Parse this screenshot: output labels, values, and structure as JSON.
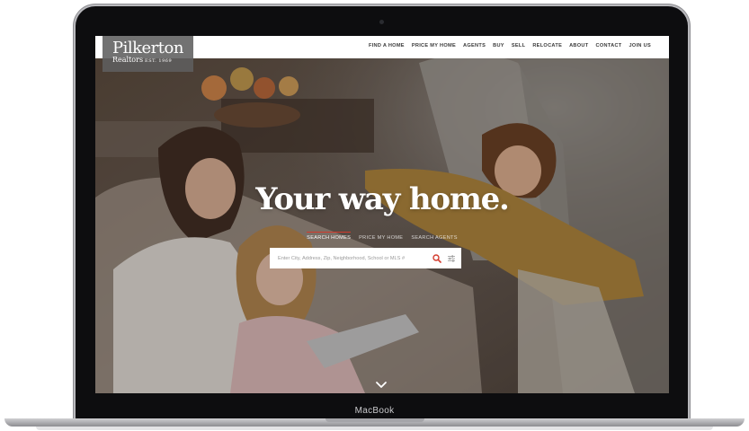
{
  "device": {
    "label": "MacBook"
  },
  "header": {
    "logo": {
      "name": "Pilkerton",
      "subtitle": "Realtors",
      "est": "EST. 1969"
    },
    "nav": [
      {
        "label": "FIND A HOME"
      },
      {
        "label": "PRICE MY HOME"
      },
      {
        "label": "AGENTS"
      },
      {
        "label": "BUY"
      },
      {
        "label": "SELL"
      },
      {
        "label": "RELOCATE"
      },
      {
        "label": "ABOUT"
      },
      {
        "label": "CONTACT"
      },
      {
        "label": "JOIN US"
      }
    ]
  },
  "hero": {
    "title": "Your way home.",
    "tabs": [
      {
        "label": "SEARCH HOMES",
        "active": true
      },
      {
        "label": "PRICE MY HOME",
        "active": false
      },
      {
        "label": "SEARCH AGENTS",
        "active": false
      }
    ],
    "search": {
      "placeholder": "Enter City, Address, Zip, Neighborhood, School or MLS #"
    }
  },
  "icons": {
    "search": "search-icon",
    "filter": "sliders-icon",
    "scroll": "chevron-down-icon",
    "accent": "#d33a2c"
  }
}
